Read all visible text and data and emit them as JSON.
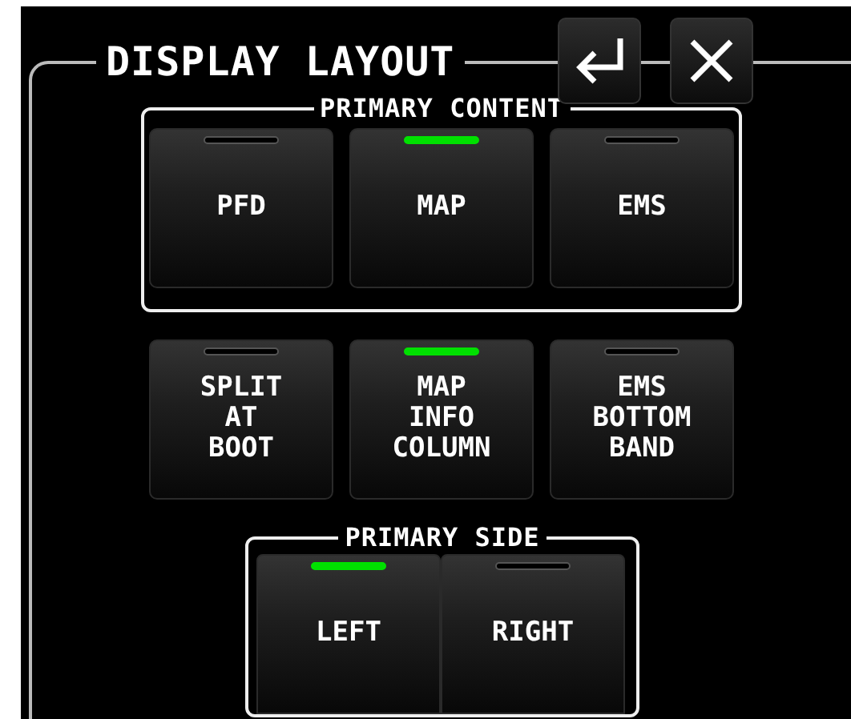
{
  "title": "DISPLAY LAYOUT",
  "primary_content": {
    "label": "PRIMARY CONTENT",
    "options": [
      {
        "label": "PFD",
        "selected": false
      },
      {
        "label": "MAP",
        "selected": true
      },
      {
        "label": "EMS",
        "selected": false
      }
    ]
  },
  "toggles": [
    {
      "label": "SPLIT\nAT\nBOOT",
      "on": false
    },
    {
      "label": "MAP\nINFO\nCOLUMN",
      "on": true
    },
    {
      "label": "EMS\nBOTTOM\nBAND",
      "on": false
    }
  ],
  "primary_side": {
    "label": "PRIMARY SIDE",
    "options": [
      {
        "label": "LEFT",
        "selected": true
      },
      {
        "label": "RIGHT",
        "selected": false
      }
    ]
  }
}
